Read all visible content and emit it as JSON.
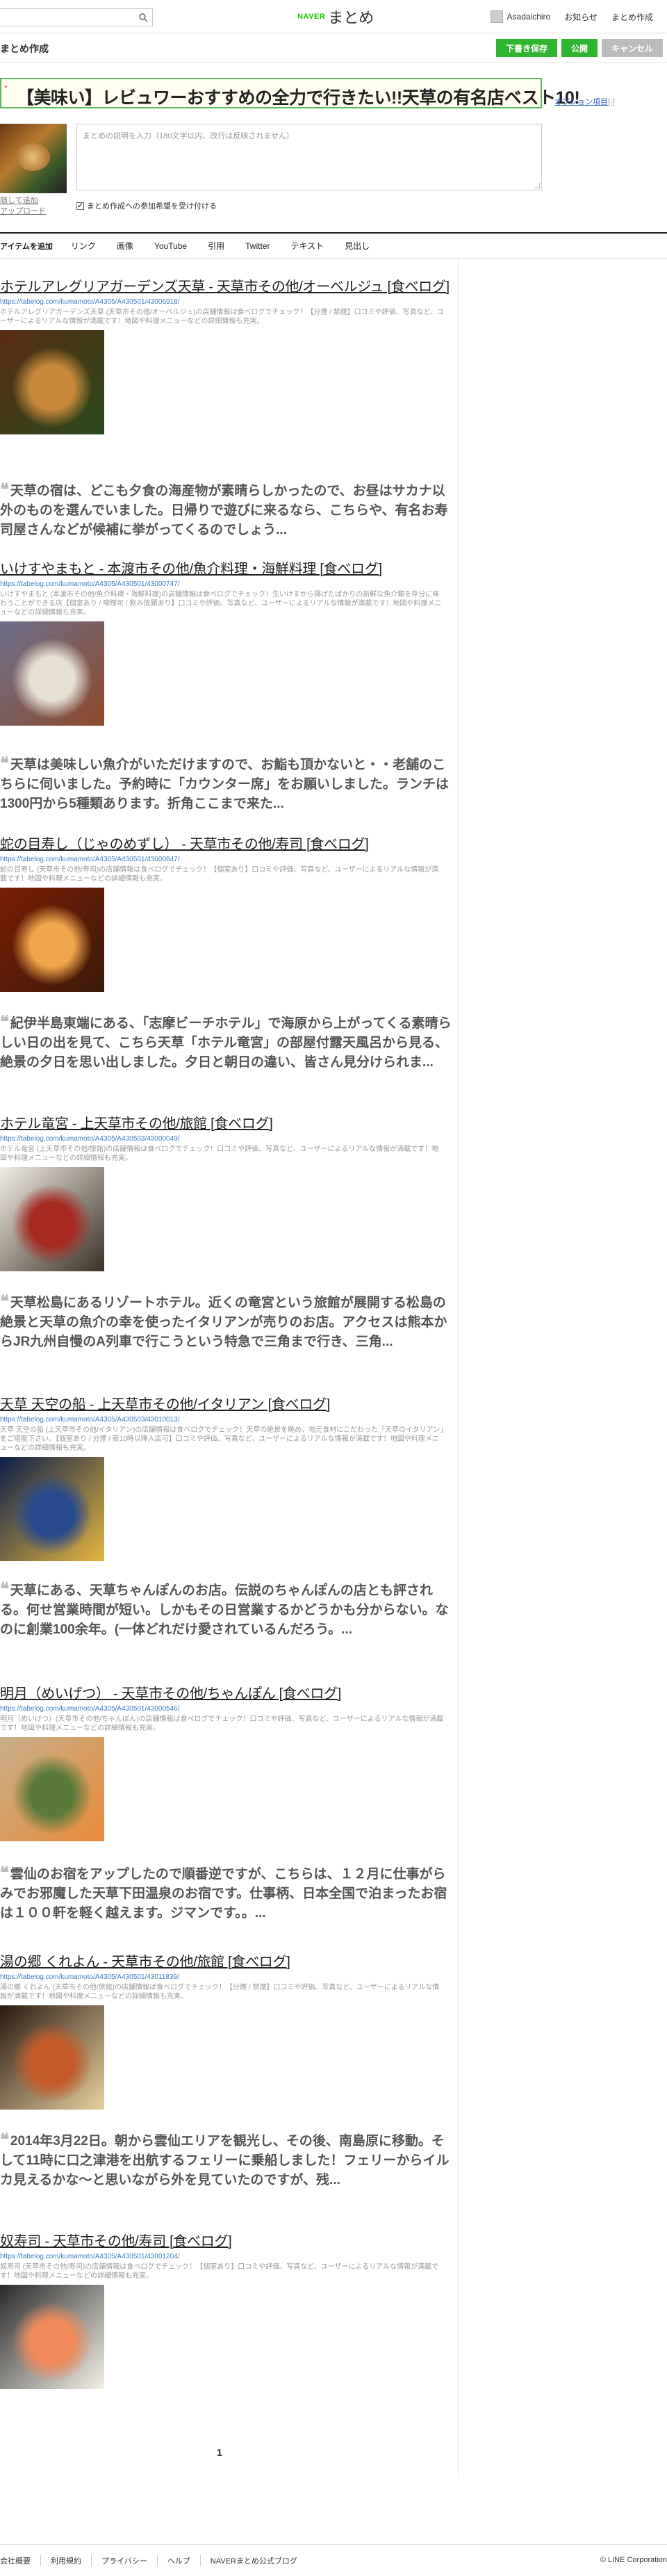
{
  "header": {
    "logo_naver": "NAVER",
    "logo_matome": "まとめ",
    "username": "Asadaichiro",
    "notice": "お知らせ",
    "create": "まとめ作成"
  },
  "editor": {
    "page_title": "まとめ作成",
    "buttons": {
      "save_draft": "下書き保存",
      "publish": "公開",
      "cancel": "キャンセル"
    },
    "title_marker": "*",
    "title_value": "【美味い】レビュワーおすすめの全力で行きたい!!天草の有名店ベスト10!",
    "options_link": "オプション項目",
    "options_toggle": "[-]",
    "thumb_links": [
      "隠して追加",
      "アップロード"
    ],
    "description_placeholder": "まとめの説明を入力（180文字以内、改行は反映されません）",
    "contribution_label": "まとめ作成への参加希望を受け付ける"
  },
  "add_toolbar": {
    "label": "アイテムを追加",
    "items": [
      "リンク",
      "画像",
      "YouTube",
      "引用",
      "Twitter",
      "テキスト",
      "見出し"
    ]
  },
  "entries": [
    {
      "title": "ホテルアレグリアガーデンズ天草 - 天草市その他/オーベルジュ [食べログ]",
      "url": "https://tabelog.com/kumamoto/A4305/A430501/43006918/",
      "desc": "ホテルアレグリアガーデンズ天草 (天草市その他/オーベルジュ)の店舗情報は食べログでチェック！【分煙 / 禁煙】口コミや評価、写真など、ユーザーによるリアルな情報が満載です！地図や料理メニューなどの詳細情報も充実。",
      "img_colors": [
        "#5a2d12",
        "#c98a3c",
        "#2b4a1e"
      ]
    },
    {
      "title": "いけすやまもと - 本渡市その他/魚介料理・海鮮料理 [食べログ]",
      "url": "https://tabelog.com/kumamoto/A4305/A430501/43000747/",
      "desc": "いけすやまもと (本渡市その他/魚介料理・海鮮料理)の店舗情報は食べログでチェック！生いけすから揚げたばかりの新鮮な魚介類を存分に味わうことができる店【個室あり / 喫煙可 / 飲み放題あり】口コミや評価、写真など、ユーザーによるリアルな情報が満載です！地図や料理メニューなどの詳細情報も充実。",
      "img_colors": [
        "#6d6f8c",
        "#e7e1d4",
        "#8e4a2b"
      ]
    },
    {
      "title": "蛇の目寿し（じゃのめずし） - 天草市その他/寿司 [食べログ]",
      "url": "https://tabelog.com/kumamoto/A4305/A430501/43000847/",
      "desc": "蛇の目寿し (天草市その他/寿司)の店舗情報は食べログでチェック！【個室あり】口コミや評価、写真など、ユーザーによるリアルな情報が満載です！地図や料理メニューなどの詳細情報も充実。",
      "img_colors": [
        "#7a1e06",
        "#f0a64a",
        "#3a1a08"
      ]
    },
    {
      "title": "ホテル竜宮 - 上天草市その他/旅館 [食べログ]",
      "url": "https://tabelog.com/kumamoto/A4305/A430503/43000049/",
      "desc": "ホテル竜宮 (上天草市その他/旅館)の店舗情報は食べログでチェック！口コミや評価、写真など、ユーザーによるリアルな情報が満載です！地図や料理メニューなどの詳細情報も充実。",
      "img_colors": [
        "#f2ede4",
        "#a62a20",
        "#3b3226"
      ]
    },
    {
      "title": "天草 天空の船 - 上天草市その他/イタリアン [食べログ]",
      "url": "https://tabelog.com/kumamoto/A4305/A430503/43010013/",
      "desc": "天草 天空の船 (上天草市その他/イタリアン)の店舗情報は食べログでチェック！天草の絶景を眺め、地元食材にこだわった「天草のイタリアン」をご堪能下さい。【個室あり / 分煙 / 夜10時以降入店可】口コミや評価、写真など、ユーザーによるリアルな情報が満載です！地図や料理メニューなどの詳細情報も充実。",
      "img_colors": [
        "#0c1e4a",
        "#274a8c",
        "#e6b640"
      ]
    },
    {
      "title": "明月（めいげつ） - 天草市その他/ちゃんぽん [食べログ]",
      "url": "https://tabelog.com/kumamoto/A4305/A430501/43000546/",
      "desc": "明月（めいげつ）(天草市その他/ちゃんぽん)の店舗情報は食べログでチェック！口コミや評価、写真など、ユーザーによるリアルな情報が満載です！地図や料理メニューなどの詳細情報も充実。",
      "img_colors": [
        "#c7b08a",
        "#5a7a3a",
        "#e88a3a"
      ]
    },
    {
      "title": "湯の郷 くれよん - 天草市その他/旅館 [食べログ]",
      "url": "https://tabelog.com/kumamoto/A4305/A430501/43011839/",
      "desc": "湯の郷 くれよん (天草市その他/旅館)の店舗情報は食べログでチェック！【分煙 / 禁煙】口コミや評価、写真など、ユーザーによるリアルな情報が満載です！地図や料理メニューなどの詳細情報も充実。",
      "img_colors": [
        "#2a1a10",
        "#c45a2a",
        "#e8d0a0"
      ]
    },
    {
      "title": "奴寿司 - 天草市その他/寿司 [食べログ]",
      "url": "https://tabelog.com/kumamoto/A4305/A430501/43001204/",
      "desc": "奴寿司 (天草市その他/寿司)の店舗情報は食べログでチェック！【個室あり】口コミや評価、写真など、ユーザーによるリアルな情報が満載です！地図や料理メニューなどの詳細情報も充実。",
      "img_colors": [
        "#2a2a2a",
        "#f08a5a",
        "#f4f0e8"
      ]
    }
  ],
  "quotes": [
    "天草の宿は、どこも夕食の海産物が素晴らしかったので、お昼はサカナ以外のものを選んでいました。日帰りで遊びに来るなら、こちらや、有名お寿司屋さんなどが候補に挙がってくるのでしょう...",
    "天草は美味しい魚介がいただけますので、お鮨も頂かないと・・老舗のこちらに伺いました。予約時に「カウンター席」をお願いしました。ランチは1300円から5種類あります。折角ここまで来た...",
    "紀伊半島東端にある、「志摩ビーチホテル」で海原から上がってくる素晴らしい日の出を見て、こちら天草「ホテル竜宮」の部屋付露天風呂から見る、絶景の夕日を思い出しました。夕日と朝日の違い、皆さん見分けられま...",
    "天草松島にあるリゾートホテル。近くの竜宮という旅館が展開する松島の絶景と天草の魚介の幸を使ったイタリアンが売りのお店。アクセスは熊本からJR九州自慢のA列車で行こうという特急で三角まで行き、三角...",
    "天草にある、天草ちゃんぽんのお店。伝説のちゃんぽんの店とも評される。何せ営業時間が短い。しかもその日営業するかどうかも分からない。なのに創業100余年。(一体どれだけ愛されているんだろう。...",
    "雲仙のお宿をアップしたので順番逆ですが、こちらは、１２月に仕事がらみでお邪魔した天草下田温泉のお宿です。仕事柄、日本全国で泊まったお宿は１００軒を軽く越えます。ジマンです。。...",
    "2014年3月22日。朝から雲仙エリアを観光し、その後、南島原に移動。そして11時に口之津港を出航するフェリーに乗船しました！フェリーからイルカ見えるかな〜と思いながら外を見ていたのですが、残..."
  ],
  "quote_mark": "❝",
  "pagination": {
    "current": "1"
  },
  "footer": {
    "links": [
      "会社概要",
      "利用規約",
      "プライバシー",
      "ヘルプ",
      "NAVERまとめ公式ブログ"
    ],
    "copyright": "© LINE Corporation"
  }
}
